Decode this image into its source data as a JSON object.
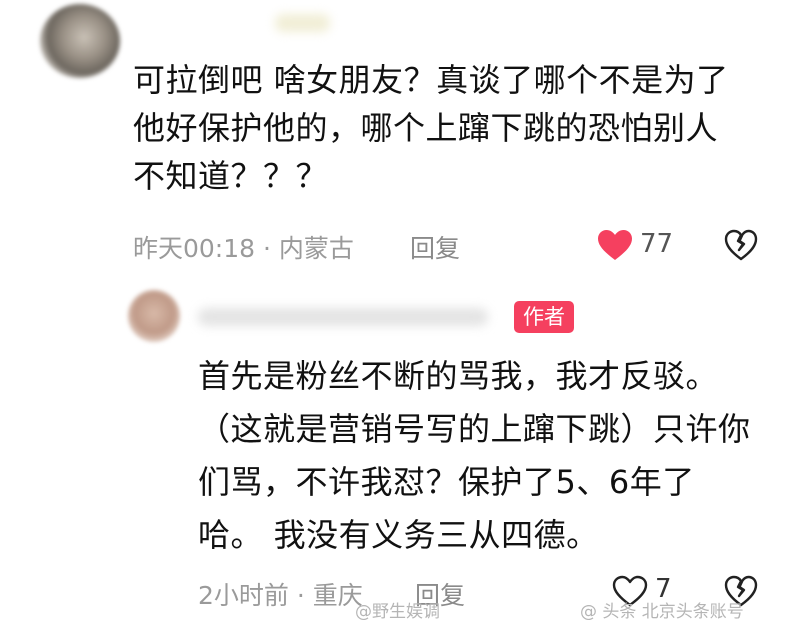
{
  "colors": {
    "like_red": "#f5405f",
    "meta_gray": "#9a9a9a",
    "text": "#111111"
  },
  "comments": [
    {
      "lines": [
        "可拉倒吧 啥女朋友？真谈了哪个不是为了",
        "他好保护他的，哪个上蹿下跳的恐怕别人",
        "不知道？？？"
      ],
      "time_location": "昨天00:18 · 内蒙古",
      "reply_label": "回复",
      "like_count": "77",
      "liked": true,
      "like_icon": "heart-filled-icon",
      "dislike_icon": "broken-heart-icon"
    },
    {
      "author_badge": "作者",
      "lines": [
        "首先是粉丝不断的骂我，我才反驳。",
        "（这就是营销号写的上蹿下跳）只许你",
        "们骂，不许我怼？保护了5、6年了",
        "哈。 我没有义务三从四德。"
      ],
      "time_location": "2小时前 · 重庆",
      "reply_label": "回复",
      "like_count": "7",
      "liked": false,
      "like_icon": "heart-outline-icon",
      "dislike_icon": "broken-heart-icon"
    }
  ],
  "watermarks": [
    "@野生娱调",
    "@ 头条 北京头条账号"
  ]
}
